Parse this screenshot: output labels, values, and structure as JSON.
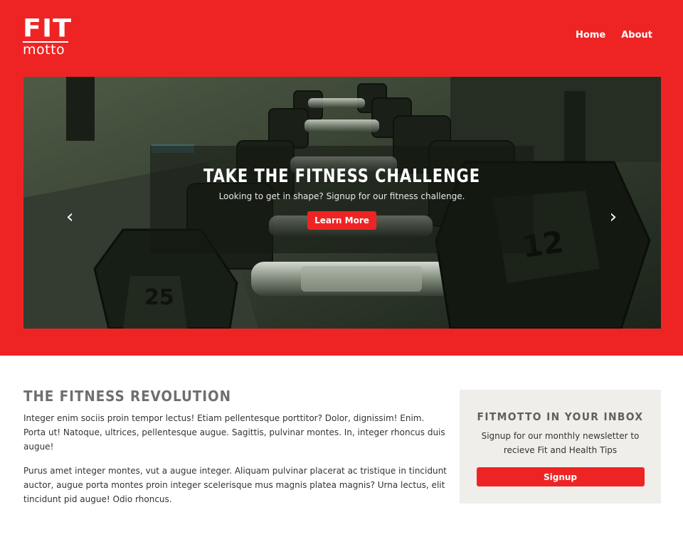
{
  "brand": {
    "logo_top": "FIT",
    "logo_bottom": "motto",
    "color": "#ee2424"
  },
  "nav": {
    "items": [
      {
        "label": "Home"
      },
      {
        "label": "About"
      }
    ]
  },
  "carousel": {
    "title": "TAKE THE FITNESS CHALLENGE",
    "text": "Looking to get in shape? Signup for our fitness challenge.",
    "button": "Learn More",
    "prev_icon": "chevron-left-icon",
    "next_icon": "chevron-right-icon"
  },
  "main": {
    "heading": "THE FITNESS REVOLUTION",
    "paragraphs": [
      "Integer enim sociis proin tempor lectus! Etiam pellentesque porttitor? Dolor, dignissim! Enim. Porta ut! Natoque, ultrices, pellentesque augue. Sagittis, pulvinar montes. In, integer rhoncus duis augue!",
      "Purus amet integer montes, vut a augue integer. Aliquam pulvinar placerat ac tristique in tincidunt auctor, augue porta montes proin integer scelerisque mus magnis platea magnis? Urna lectus, elit tincidunt pid augue! Odio rhoncus."
    ]
  },
  "sidebar": {
    "heading": "FITMOTTO IN YOUR INBOX",
    "text": "Signup for our monthly newsletter to recieve Fit and Health Tips",
    "button": "Signup"
  }
}
